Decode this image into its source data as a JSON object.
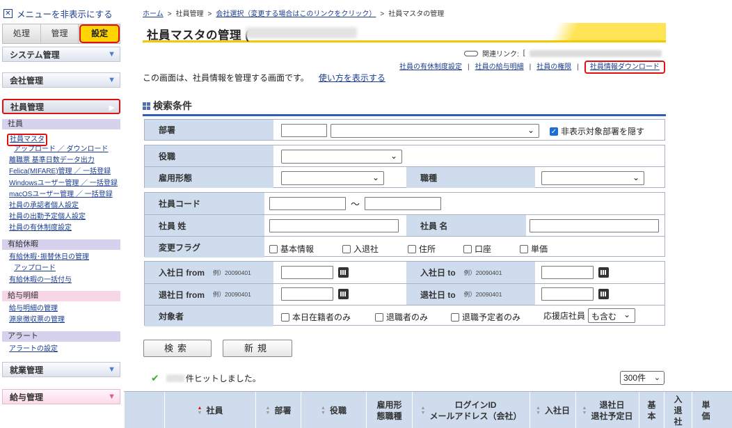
{
  "sidebar": {
    "hide_menu": "メニューを非表示にする",
    "tabs": [
      "処理",
      "管理",
      "設定"
    ],
    "sections": {
      "system": "システム管理",
      "company": "会社管理",
      "employee": "社員管理",
      "work": "就業管理",
      "payroll": "給与管理"
    },
    "categories": {
      "employee": "社員",
      "paid_leave": "有給休暇",
      "payslip": "給与明細",
      "alert": "アラート"
    },
    "employee_links": [
      "社員マスタ",
      "アップロード ／ ダウンロード",
      "離職票 基準日数データ出力",
      "Felica(MIFARE)管理 ／ 一括登録",
      "Windowsユーザー管理 ／ 一括登録",
      "macOSユーザー管理 ／ 一括登録",
      "社員の承認者個人設定",
      "社員の出勤予定個人設定",
      "社員の有休制度設定"
    ],
    "paid_leave_links": [
      "有給休暇･振替休日の管理",
      "アップロード",
      "有給休暇の一括付与"
    ],
    "payslip_links": [
      "給与明細の管理",
      "源泉徴収票の管理"
    ],
    "alert_links": [
      "アラートの設定"
    ]
  },
  "breadcrumb": {
    "home": "ホーム",
    "employee_mgmt": "社員管理",
    "company_select": "会社選択（変更する場合はこのリンクをクリック）",
    "current": "社員マスタの管理"
  },
  "page": {
    "title": "社員マスタの管理 (",
    "related_label": "関連リンク:",
    "related_prefix": "[",
    "top_links": [
      "社員の有休制度設定",
      "社員の給与明細",
      "社員の権限",
      "社員情報ダウンロード"
    ],
    "description": "この画面は、社員情報を管理する画面です。",
    "howto_link": "使い方を表示する",
    "search_title": "検索条件"
  },
  "form": {
    "dept": "部署",
    "hide_hidden_dept": "非表示対象部署を隠す",
    "position": "役職",
    "employment_type": "雇用形態",
    "job_type": "職種",
    "emp_code": "社員コード",
    "tilde": "〜",
    "last_name": "社員 姓",
    "first_name": "社員 名",
    "change_flag": "変更フラグ",
    "flags": [
      "基本情報",
      "入退社",
      "住所",
      "口座",
      "単価"
    ],
    "join_from": "入社日 from",
    "join_to": "入社日 to",
    "leave_from": "退社日 from",
    "leave_to": "退社日 to",
    "date_example": "例）20090401",
    "target": "対象者",
    "targets": [
      "本日在籍者のみ",
      "退職者のみ",
      "退職予定者のみ"
    ],
    "support_staff": "応援店社員",
    "support_value": "も含む"
  },
  "buttons": {
    "search": "検索",
    "new": "新規"
  },
  "results": {
    "hits_suffix": "件ヒットしました。",
    "per_page": "300件"
  },
  "table_headers": {
    "employee": "社員",
    "dept": "部署",
    "position": "役職",
    "employment": "雇用形態職種",
    "login": "ログインID\nメールアドレス（会社）",
    "join": "入社日",
    "leave": "退社日\n退社予定日",
    "basic": "基本",
    "in_out": "入退社",
    "price": "単価"
  },
  "colors": {
    "accent_blue": "#2f5fb3",
    "label_bg": "#cfdcee",
    "highlight_red": "#dd1111",
    "tab_active": "#ffd400"
  }
}
